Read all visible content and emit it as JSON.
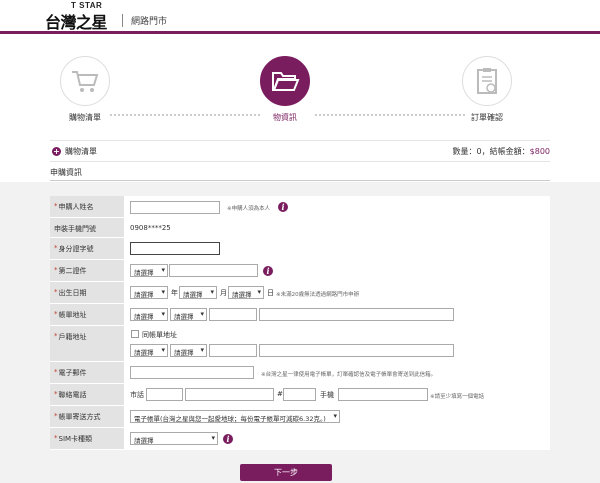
{
  "header": {
    "logo_top": "T STAR",
    "logo_main": "台灣之星",
    "logo_sub": "網路門市",
    "accent_color": "#7a1d5f"
  },
  "steps": [
    {
      "label": "購物清單",
      "icon": "shopping-cart-icon",
      "active": false
    },
    {
      "label": "物資訊",
      "icon": "folder-open-icon",
      "active": true
    },
    {
      "label": "訂單確認",
      "icon": "clipboard-check-icon",
      "active": false
    }
  ],
  "summary": {
    "cart_label": "購物清單",
    "totals_prefix": "數量：0，結帳金額：",
    "amount": "$800"
  },
  "section_title": "申購資訊",
  "form": {
    "applicant_name": {
      "label": "申購人姓名",
      "required": true,
      "value": "",
      "note": "※申購人須為本人"
    },
    "phone": {
      "label": "申裝手機門號",
      "required": false,
      "value": "0908****25"
    },
    "id_number": {
      "label": "身分證字號",
      "required": true,
      "value": ""
    },
    "second_id": {
      "label": "第二證件",
      "required": true,
      "select": "請選擇",
      "value": ""
    },
    "birthday": {
      "label": "出生日期",
      "required": true,
      "year": "請選擇",
      "year_unit": "年",
      "month": "請選擇",
      "month_unit": "月",
      "day": "請選擇",
      "day_unit": "日",
      "note": "※未滿20歲無法透過網路門市申辦"
    },
    "billing_address": {
      "label": "帳單地址",
      "required": true,
      "city": "請選擇",
      "district": "請選擇"
    },
    "household_address": {
      "label": "戶籍地址",
      "required": true,
      "same_as_billing": "同帳單地址",
      "city": "請選擇",
      "district": "請選擇"
    },
    "email": {
      "label": "電子郵件",
      "required": true,
      "value": "",
      "note": "※台灣之星一律使用電子帳單，訂單確認信及電子帳單會寄送到此信箱。"
    },
    "contact_phone": {
      "label": "聯絡電話",
      "required": true,
      "city_label": "市話",
      "hash": "#",
      "mobile_label": "手機",
      "note": "※請至少填寫一個電話"
    },
    "bill_delivery": {
      "label": "帳單寄送方式",
      "required": true,
      "value": "電子帳單(台灣之星與您一起愛地球；每份電子帳單可減碳6.32克。)"
    },
    "sim_type": {
      "label": "SIM卡種類",
      "required": true,
      "value": "請選擇"
    }
  },
  "submit_label": "下一步"
}
